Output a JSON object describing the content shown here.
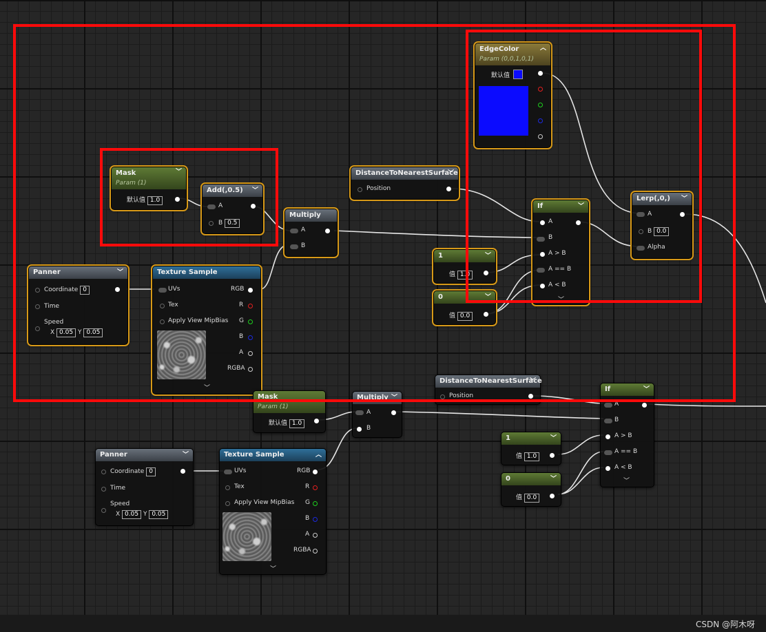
{
  "nodes": {
    "edgecolor": {
      "title": "EdgeColor",
      "subtitle": "Param (0,0,1,0,1)",
      "default_label": "默认值"
    },
    "mask1": {
      "title": "Mask",
      "subtitle": "Param (1)",
      "default_label": "默认值",
      "value": "1.0"
    },
    "add1": {
      "title": "Add(,0.5)",
      "pin_a": "A",
      "pin_b": "B",
      "b_value": "0.5"
    },
    "distance1": {
      "title": "DistanceToNearestSurface",
      "pin_position": "Position"
    },
    "multiply1": {
      "title": "Multiply",
      "pin_a": "A",
      "pin_b": "B"
    },
    "if1": {
      "title": "If",
      "pins": [
        "A",
        "B",
        "A > B",
        "A == B",
        "A < B"
      ]
    },
    "lerp1": {
      "title": "Lerp(,0,)",
      "pin_a": "A",
      "pin_b": "B",
      "b_value": "0.0",
      "pin_alpha": "Alpha"
    },
    "panner1": {
      "title": "Panner",
      "coordinate": "Coordinate",
      "coordinate_value": "0",
      "time": "Time",
      "speed": "Speed",
      "x_label": "X",
      "x_value": "0.05",
      "y_label": "Y",
      "y_value": "0.05"
    },
    "texsample1": {
      "title": "Texture Sample",
      "uvs": "UVs",
      "tex": "Tex",
      "mipbias": "Apply View MipBias",
      "rgb": "RGB",
      "r": "R",
      "g": "G",
      "b": "B",
      "a": "A",
      "rgba": "RGBA"
    },
    "const1a": {
      "title": "1",
      "label": "值",
      "value": "1.0"
    },
    "const0a": {
      "title": "0",
      "label": "值",
      "value": "0.0"
    },
    "mask2": {
      "title": "Mask",
      "subtitle": "Param (1)",
      "default_label": "默认值",
      "value": "1.0"
    },
    "multiply2": {
      "title": "Multiply",
      "pin_a": "A",
      "pin_b": "B"
    },
    "distance2": {
      "title": "DistanceToNearestSurface",
      "pin_position": "Position"
    },
    "if2": {
      "title": "If",
      "pins": [
        "A",
        "B",
        "A > B",
        "A == B",
        "A < B"
      ]
    },
    "panner2": {
      "title": "Panner",
      "coordinate": "Coordinate",
      "coordinate_value": "0",
      "time": "Time",
      "speed": "Speed",
      "x_label": "X",
      "x_value": "0.05",
      "y_label": "Y",
      "y_value": "0.05"
    },
    "texsample2": {
      "title": "Texture Sample",
      "uvs": "UVs",
      "tex": "Tex",
      "mipbias": "Apply View MipBias",
      "rgb": "RGB",
      "r": "R",
      "g": "G",
      "b": "B",
      "a": "A",
      "rgba": "RGBA"
    },
    "const1b": {
      "title": "1",
      "label": "值",
      "value": "1.0"
    },
    "const0b": {
      "title": "0",
      "label": "值",
      "value": "0.0"
    }
  },
  "colors": {
    "edge_color": "#0b0bff",
    "annotation": "#ff0a0a",
    "selection": "#d89a18"
  },
  "watermark": "CSDN @阿木呀"
}
